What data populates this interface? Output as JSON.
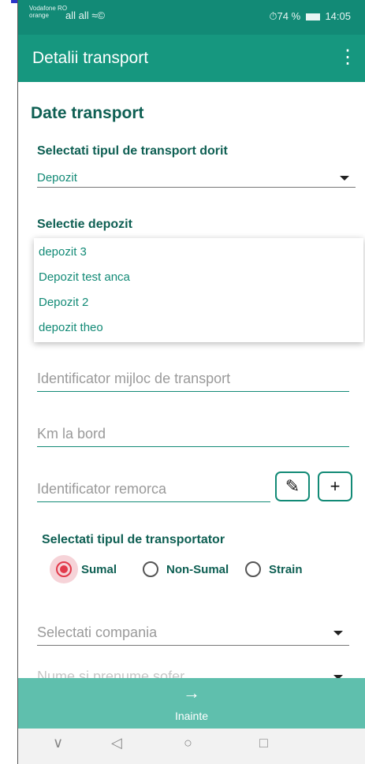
{
  "status_bar": {
    "carrier": "Vodafone RO",
    "carrier_sub": "orange",
    "signal_icons": "all all ≈©",
    "battery_text": "⏱74 %",
    "time": "14:05"
  },
  "app_bar": {
    "title": "Detalii transport",
    "menu_icon": "⋮"
  },
  "section_title": "Date transport",
  "transport_type": {
    "label": "Selectati tipul de transport dorit",
    "selected": "Depozit"
  },
  "depot": {
    "label": "Selectie depozit",
    "options": [
      "depozit 3",
      "Depozit test anca",
      "Depozit 2",
      "depozit theo"
    ]
  },
  "fields": {
    "vehicle_id_placeholder": "Identificator mijloc de transport",
    "km_placeholder": "Km la bord",
    "trailer_placeholder": "Identificator remorca"
  },
  "buttons": {
    "edit_icon": "✎",
    "add_icon": "+"
  },
  "carrier_type": {
    "label": "Selectati tipul de transportator",
    "options": [
      "Sumal",
      "Non-Sumal",
      "Strain"
    ],
    "selected": "Sumal"
  },
  "company": {
    "placeholder": "Selectati compania"
  },
  "driver": {
    "placeholder": "Nume si prenume sofer"
  },
  "next": {
    "arrow": "→",
    "label": "Inainte"
  },
  "nav": {
    "back": "◁",
    "home": "○",
    "recents": "□",
    "down": "∨"
  },
  "colors": {
    "primary": "#16977f",
    "status": "#128a76",
    "accent": "#e23a4b",
    "next_bar": "#5fbfad"
  }
}
